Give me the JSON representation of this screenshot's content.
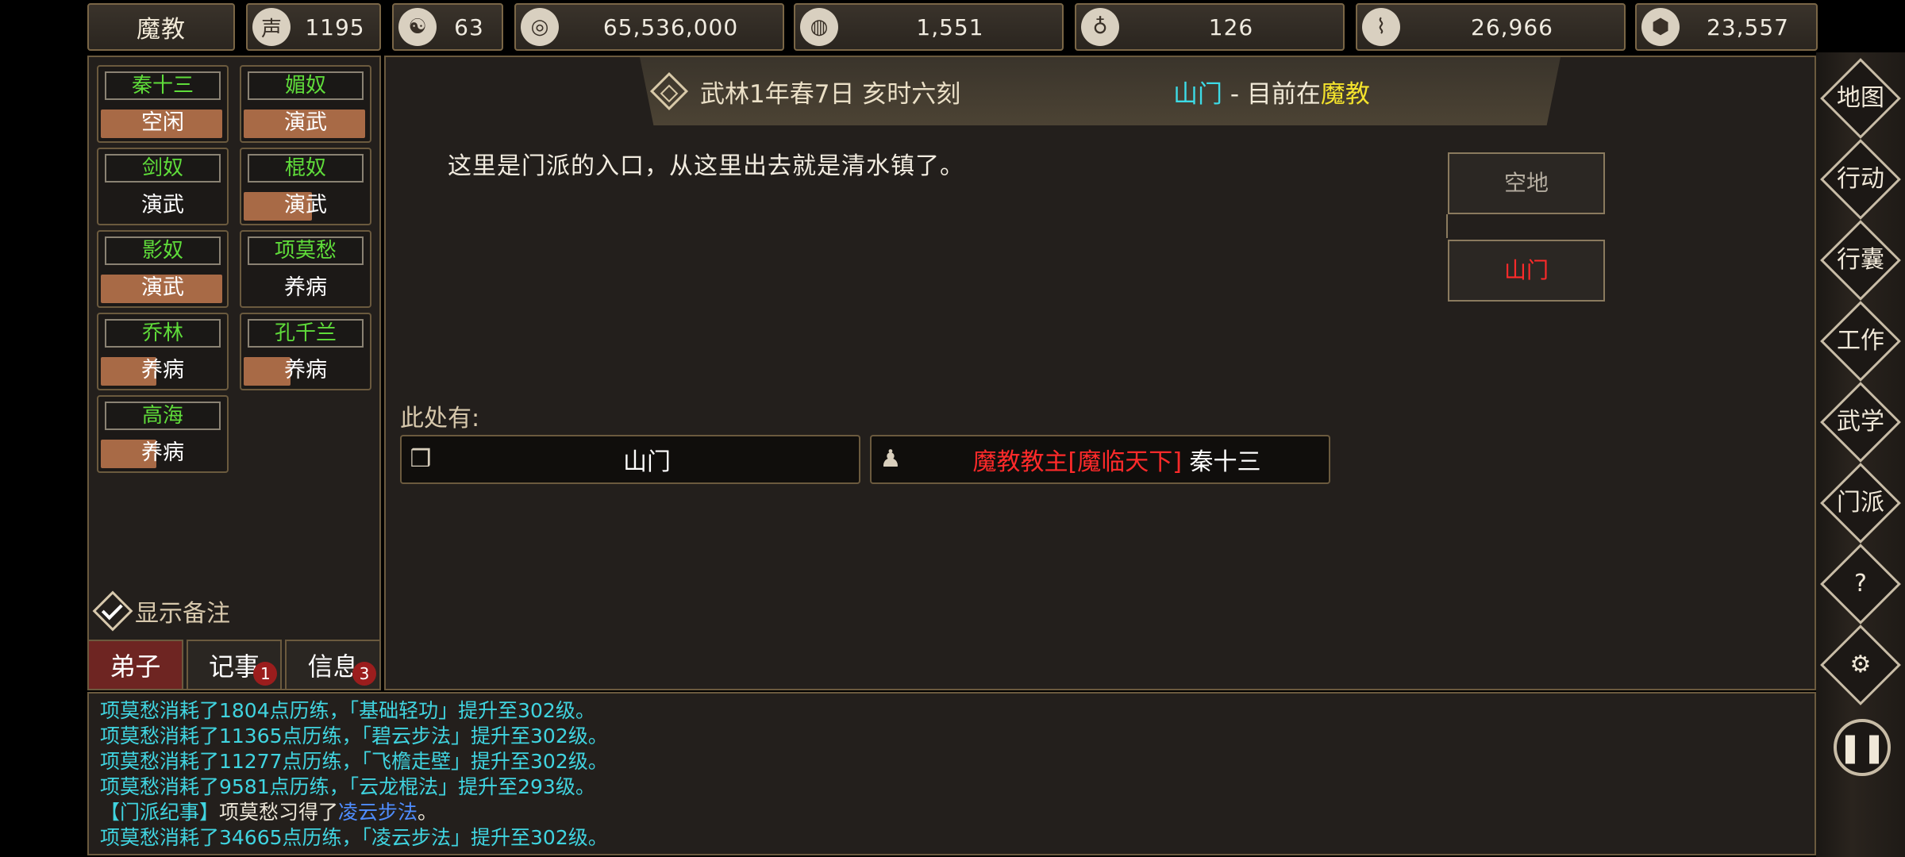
{
  "topbar": {
    "sect_name": "魔教",
    "resources": [
      {
        "icon": "reputation-icon",
        "glyph": "声",
        "value": "1195"
      },
      {
        "icon": "yin-yang-icon",
        "glyph": "☯",
        "value": "63"
      },
      {
        "icon": "coin-icon",
        "glyph": "◎",
        "value": "65,536,000"
      },
      {
        "icon": "food-bowl-icon",
        "glyph": "◍",
        "value": "1,551"
      },
      {
        "icon": "gourd-icon",
        "glyph": "♁",
        "value": "126"
      },
      {
        "icon": "wood-log-icon",
        "glyph": "⌇",
        "value": "26,966"
      },
      {
        "icon": "ore-icon",
        "glyph": "⬢",
        "value": "23,557"
      }
    ]
  },
  "disciples": [
    {
      "name": "秦十三",
      "status": "空闲",
      "progress": 0.98
    },
    {
      "name": "媚奴",
      "status": "演武",
      "progress": 0.98
    },
    {
      "name": "剑奴",
      "status": "演武",
      "progress": 0.0
    },
    {
      "name": "棍奴",
      "status": "演武",
      "progress": 0.55
    },
    {
      "name": "影奴",
      "status": "演武",
      "progress": 0.98
    },
    {
      "name": "项莫愁",
      "status": "养病",
      "progress": 0.0
    },
    {
      "name": "乔林",
      "status": "养病",
      "progress": 0.45
    },
    {
      "name": "孔千兰",
      "status": "养病",
      "progress": 0.38
    },
    {
      "name": "高海",
      "status": "养病",
      "progress": 0.45
    }
  ],
  "sidebar": {
    "show_notes": "显示备注",
    "tabs": [
      {
        "label": "弟子",
        "badge": ""
      },
      {
        "label": "记事",
        "badge": "1"
      },
      {
        "label": "信息",
        "badge": "3"
      }
    ]
  },
  "header": {
    "date": "武林1年春7日 亥时六刻",
    "location": "山门",
    "separator": " - ",
    "current_prefix": "目前在",
    "current_sect": "魔教"
  },
  "scene": {
    "description": "这里是门派的入口，从这里出去就是清水镇了。",
    "map_rooms": [
      {
        "name": "空地",
        "color": "#b5ada0"
      },
      {
        "name": "山门",
        "color": "#ff2a2a"
      }
    ],
    "here_label": "此处有:",
    "entities": [
      {
        "icon": "box-icon",
        "glyph": "❒",
        "title": "",
        "name": "山门"
      },
      {
        "icon": "person-icon",
        "glyph": "♟",
        "title": "魔教教主[魔临天下]",
        "name": "秦十三"
      }
    ]
  },
  "log": [
    {
      "text": "项莫愁消耗了1804点历练，「基础轻功」提升至302级。"
    },
    {
      "text": "项莫愁消耗了11365点历练，「碧云步法」提升至302级。"
    },
    {
      "text": "项莫愁消耗了11277点历练，「飞檐走壁」提升至302级。"
    },
    {
      "text": "项莫愁消耗了9581点历练，「云龙棍法」提升至293级。"
    },
    {
      "prefix": "【门派纪事】",
      "middle": "项莫愁习得了",
      "skill": "凌云步法",
      "suffix": "。"
    },
    {
      "text": "项莫愁消耗了34665点历练，「凌云步法」提升至302级。"
    }
  ],
  "rightmenu": {
    "buttons": [
      "地图",
      "行动",
      "行囊",
      "工作",
      "武学",
      "门派"
    ],
    "help": "?",
    "settings": "⚙",
    "pause": "❚❚"
  },
  "colors": {
    "accent_gold": "#7a6646",
    "disciple_name": "#5fdc3a",
    "progress_bar": "#a86a46",
    "log_cyan": "#40d4e0",
    "highlight_red": "#ff2a2a",
    "sect_yellow": "#f4e32c"
  }
}
